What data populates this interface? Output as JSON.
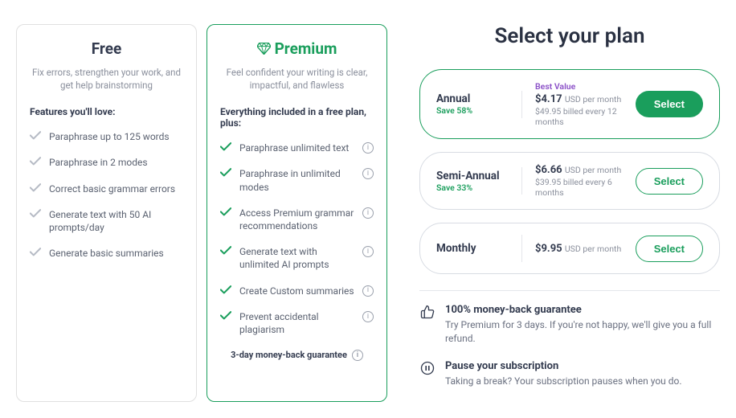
{
  "free": {
    "title": "Free",
    "desc": "Fix errors, strengthen your work, and get help brainstorming",
    "heading": "Features you'll love:",
    "features": [
      "Paraphrase up to 125 words",
      "Paraphrase in 2 modes",
      "Correct basic grammar errors",
      "Generate text with 50 AI prompts/day",
      "Generate basic summaries"
    ]
  },
  "premium": {
    "title": "Premium",
    "desc": "Feel confident your writing is clear, impactful, and flawless",
    "heading": "Everything included in a free plan, plus:",
    "features": [
      "Paraphrase unlimited text",
      "Paraphrase in unlimited modes",
      "Access Premium grammar recommendations",
      "Generate text with unlimited AI prompts",
      "Create Custom summaries",
      "Prevent accidental plagiarism"
    ],
    "guarantee": "3-day money-back guarantee"
  },
  "selector": {
    "title": "Select your plan",
    "plans": [
      {
        "name": "Annual",
        "save": "Save 58%",
        "badge": "Best Value",
        "price": "$4.17",
        "per": "USD per month",
        "billed": "$49.95 billed every 12 months",
        "button": "Select",
        "selected": true
      },
      {
        "name": "Semi-Annual",
        "save": "Save 33%",
        "badge": "",
        "price": "$6.66",
        "per": "USD per month",
        "billed": "$39.95 billed every 6 months",
        "button": "Select",
        "selected": false
      },
      {
        "name": "Monthly",
        "save": "",
        "badge": "",
        "price": "$9.95",
        "per": "USD per month",
        "billed": "",
        "button": "Select",
        "selected": false
      }
    ],
    "notes": [
      {
        "icon": "thumb",
        "title": "100% money-back guarantee",
        "desc": "Try Premium for 3 days. If you're not happy, we'll give you a full refund."
      },
      {
        "icon": "pause",
        "title": "Pause your subscription",
        "desc": "Taking a break? Your subscription pauses when you do."
      }
    ]
  },
  "colors": {
    "accent": "#1a9e5c",
    "muted": "#b6bbc5"
  }
}
